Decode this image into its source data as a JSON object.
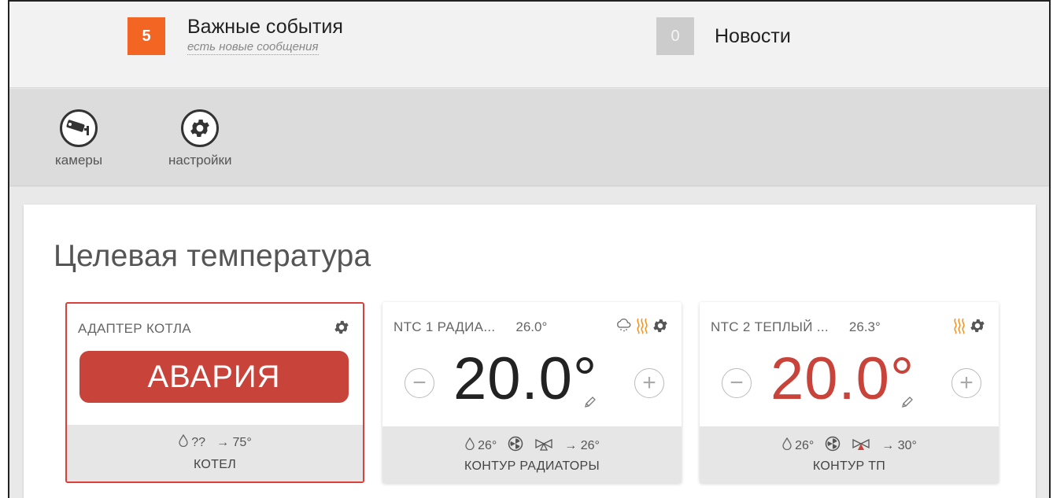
{
  "notifications": {
    "important": {
      "count": "5",
      "title": "Важные события",
      "subtitle": "есть новые сообщения",
      "color": "#f26522"
    },
    "news": {
      "count": "0",
      "title": "Новости"
    }
  },
  "toolbar": {
    "cameras_label": "камеры",
    "settings_label": "настройки"
  },
  "panel": {
    "title": "Целевая температура",
    "cards": [
      {
        "name": "АДАПТЕР КОТЛА",
        "status": "АВАРИЯ",
        "foot_pressure": "??",
        "foot_out": "→ 75°",
        "label": "КОТЕЛ",
        "icons": [
          "gear-icon"
        ]
      },
      {
        "name": "NTC 1 РАДИА...",
        "current": "26.0°",
        "setpoint": "20.0°",
        "foot_temp": "26°",
        "foot_out": "→ 26°",
        "label": "КОНТУР РАДИАТОРЫ",
        "icons": [
          "weather-icon",
          "heating-icon",
          "gear-icon"
        ]
      },
      {
        "name": "NTC 2 ТЕПЛЫЙ ...",
        "current": "26.3°",
        "setpoint": "20.0°",
        "foot_temp": "26°",
        "foot_out": "→ 30°",
        "label": "КОНТУР ТП",
        "icons": [
          "heating-icon",
          "gear-icon"
        ]
      }
    ]
  },
  "colors": {
    "alarm": "#c8433a",
    "heating": "#f7941d",
    "badge_important": "#f26522",
    "badge_news": "#cccccc"
  }
}
